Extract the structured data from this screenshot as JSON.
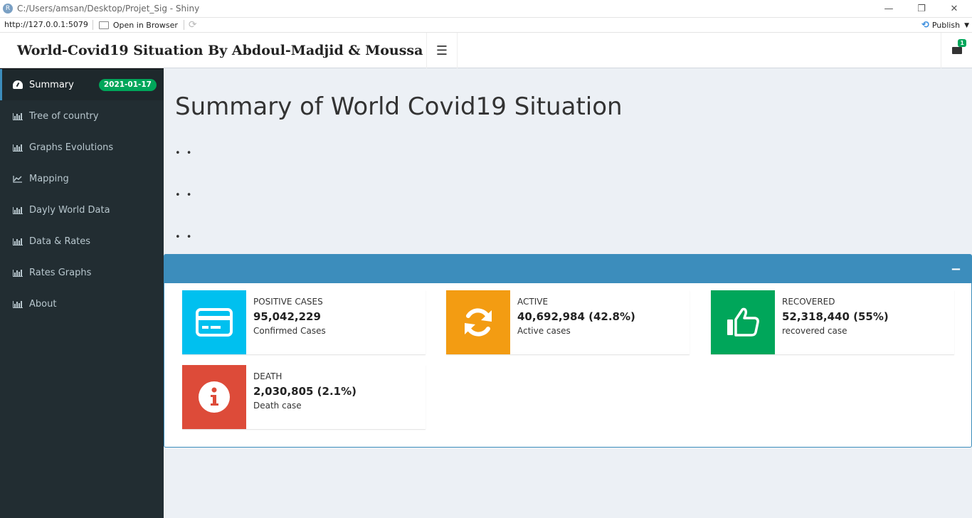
{
  "window": {
    "title": "C:/Users/amsan/Desktop/Projet_Sig - Shiny",
    "app_icon": "R",
    "minimize": "—",
    "restore": "❐",
    "close": "✕"
  },
  "toolbar": {
    "url": "http://127.0.0.1:5079",
    "open_browser": "Open in Browser",
    "refresh_icon": "refresh-icon",
    "publish": "Publish"
  },
  "header": {
    "title": "World-Covid19 Situation By Abdoul-Madjid & Moussa",
    "menu_icon": "☰",
    "messages_count": "1"
  },
  "sidebar": {
    "items": [
      {
        "label": "Summary",
        "icon": "dashboard-icon",
        "badge": "2021-01-17",
        "active": true
      },
      {
        "label": "Tree of country",
        "icon": "bar-chart-icon"
      },
      {
        "label": "Graphs Evolutions",
        "icon": "bar-chart-icon"
      },
      {
        "label": "Mapping",
        "icon": "line-chart-icon"
      },
      {
        "label": "Dayly World Data",
        "icon": "bar-chart-icon"
      },
      {
        "label": "Data & Rates",
        "icon": "bar-chart-icon"
      },
      {
        "label": "Rates Graphs",
        "icon": "bar-chart-icon"
      },
      {
        "label": "About",
        "icon": "bar-chart-icon"
      }
    ]
  },
  "main": {
    "title": "Summary of World Covid19 Situation",
    "dots": [
      "• •",
      "• •",
      "• •"
    ],
    "box": {
      "collapse": "−",
      "info_boxes": [
        {
          "title": "POSITIVE CASES",
          "value": "95,042,229",
          "subtitle": "Confirmed Cases",
          "icon": "credit-card-icon",
          "color": "#00c0ef"
        },
        {
          "title": "ACTIVE",
          "value": "40,692,984 (42.8%)",
          "subtitle": "Active cases",
          "icon": "refresh-icon",
          "color": "#f39c12"
        },
        {
          "title": "RECOVERED",
          "value": "52,318,440 (55%)",
          "subtitle": "recovered case",
          "icon": "thumbs-up-icon",
          "color": "#00a65a"
        },
        {
          "title": "DEATH",
          "value": "2,030,805 (2.1%)",
          "subtitle": "Death case",
          "icon": "info-icon",
          "color": "#dd4b39"
        }
      ]
    }
  }
}
